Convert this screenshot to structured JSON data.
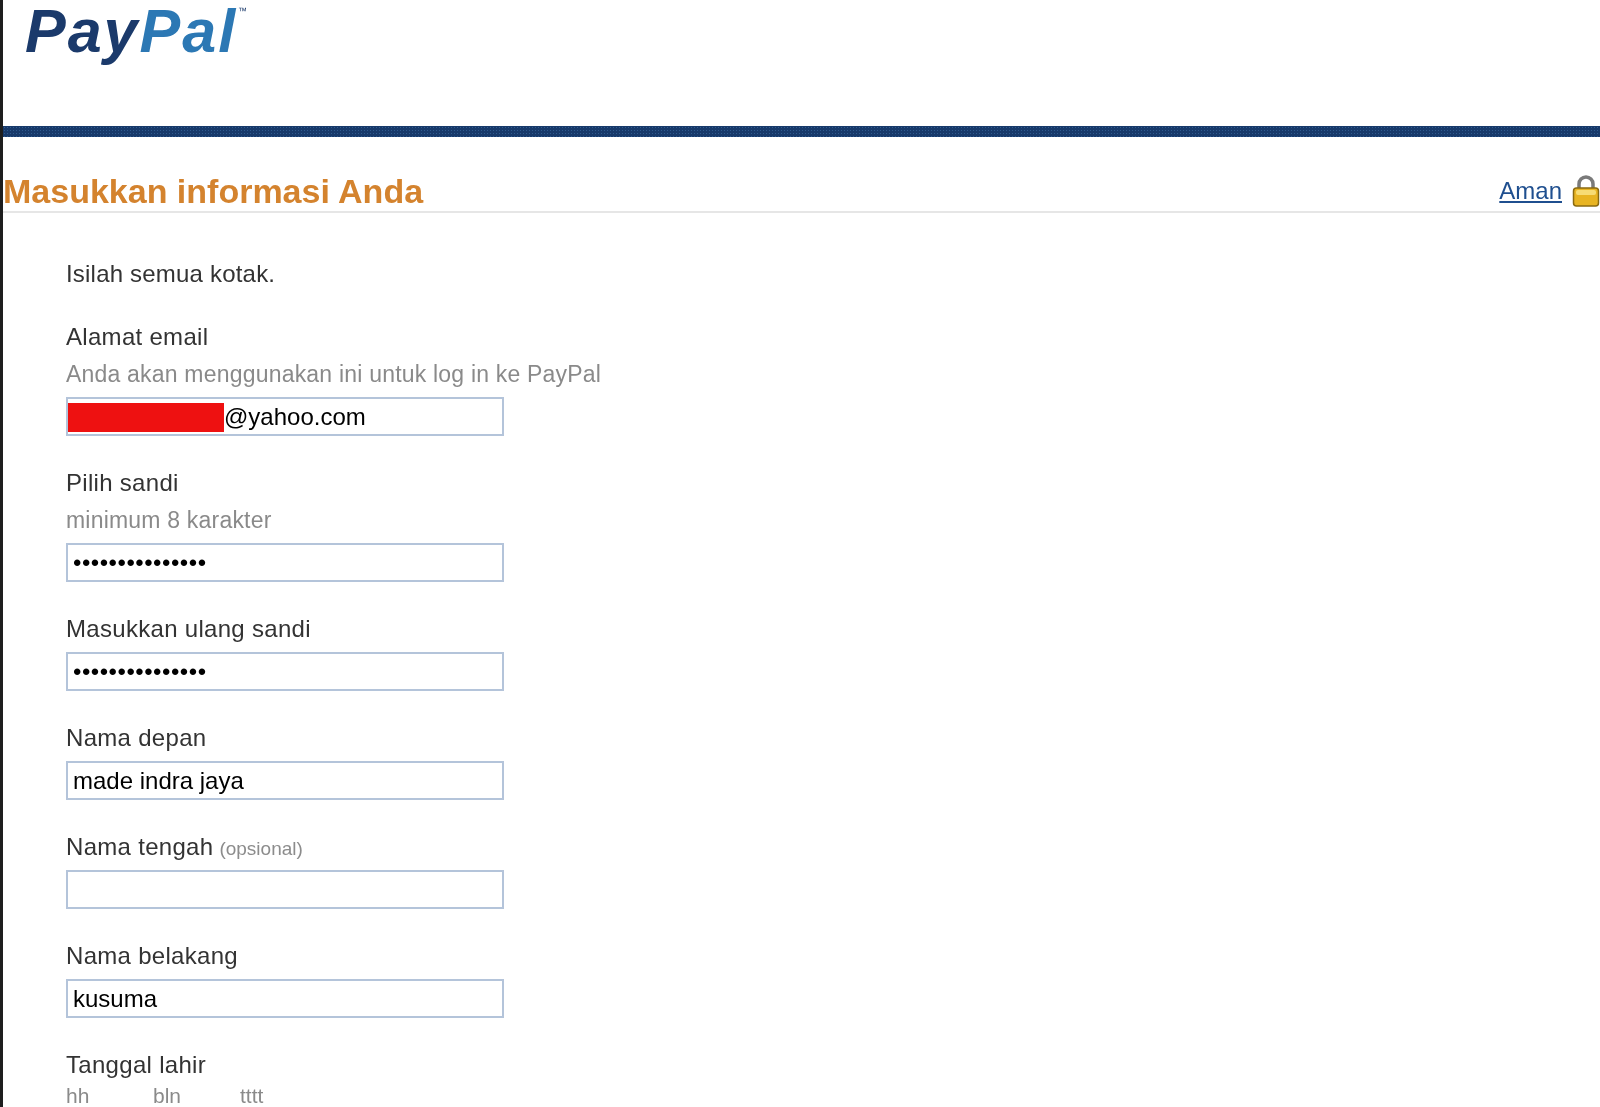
{
  "logo": {
    "parts": [
      "Pay",
      "Pal"
    ],
    "trademark": "™"
  },
  "section": {
    "title": "Masukkan informasi Anda",
    "secure_link": "Aman"
  },
  "intro": "Isilah semua kotak.",
  "fields": [
    {
      "kind": "text",
      "label": "Alamat email",
      "hint": "Anda akan menggunakan ini untuk log in ke PayPal",
      "value": "@yahoo.com",
      "redacted": true
    },
    {
      "kind": "password",
      "label": "Pilih sandi",
      "hint": "minimum 8 karakter",
      "value": "•••••••••••••••"
    },
    {
      "kind": "password",
      "label": "Masukkan ulang sandi",
      "value": "•••••••••••••••"
    },
    {
      "kind": "text",
      "label": "Nama depan",
      "value": "made indra jaya"
    },
    {
      "kind": "text",
      "label": "Nama tengah",
      "label_note": "(opsional)"
    },
    {
      "kind": "text",
      "label": "Nama belakang",
      "value": "kusuma"
    },
    {
      "kind": "date",
      "label": "Tanggal lahir",
      "parts": [
        "hh",
        "bln",
        "tttt"
      ]
    }
  ]
}
